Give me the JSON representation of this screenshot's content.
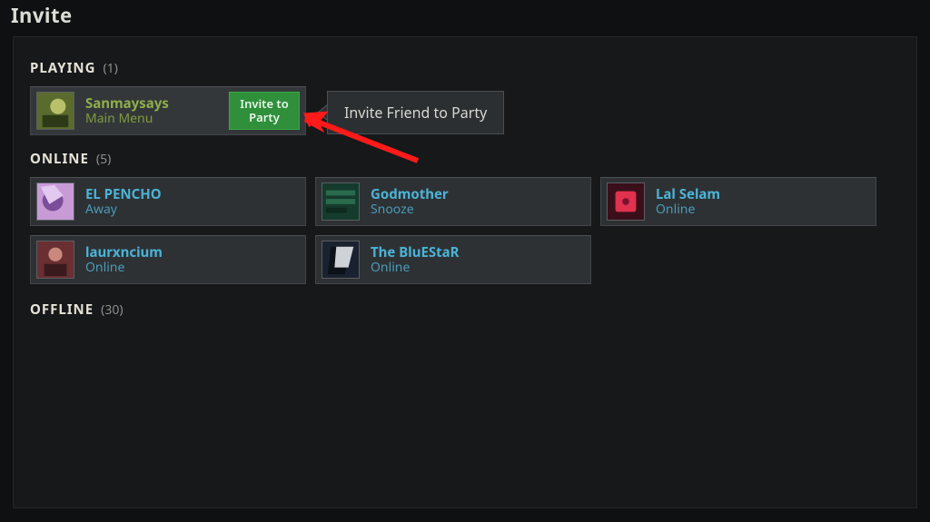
{
  "title": "Invite",
  "tooltip": "Invite Friend to Party",
  "sections": {
    "playing": {
      "label": "PLAYING",
      "count": "(1)"
    },
    "online": {
      "label": "ONLINE",
      "count": "(5)"
    },
    "offline": {
      "label": "OFFLINE",
      "count": "(30)"
    }
  },
  "invite_button": {
    "line1": "Invite to",
    "line2": "Party"
  },
  "friends": {
    "playing": [
      {
        "name": "Sanmaysays",
        "status": "Main Menu",
        "avatar_colors": [
          "#5a6b2d",
          "#b8c06a",
          "#2e3a17"
        ]
      }
    ],
    "online": [
      {
        "name": "EL PENCHO",
        "status": "Away",
        "avatar_colors": [
          "#c89bd6",
          "#7a4e9a",
          "#e3c8ef"
        ]
      },
      {
        "name": "Godmother",
        "status": "Snooze",
        "avatar_colors": [
          "#153b2d",
          "#2a6b4e",
          "#0d2a20"
        ]
      },
      {
        "name": "Lal Selam",
        "status": "Online",
        "avatar_colors": [
          "#3a0f1a",
          "#e0314f",
          "#7a1230"
        ]
      },
      {
        "name": "laurxncium",
        "status": "Online",
        "avatar_colors": [
          "#6a2f33",
          "#c98a7d",
          "#3a1a1d"
        ]
      },
      {
        "name": "The BluEStaR",
        "status": "Online",
        "avatar_colors": [
          "#1a2230",
          "#cfd3d8",
          "#0d1118"
        ]
      }
    ]
  }
}
